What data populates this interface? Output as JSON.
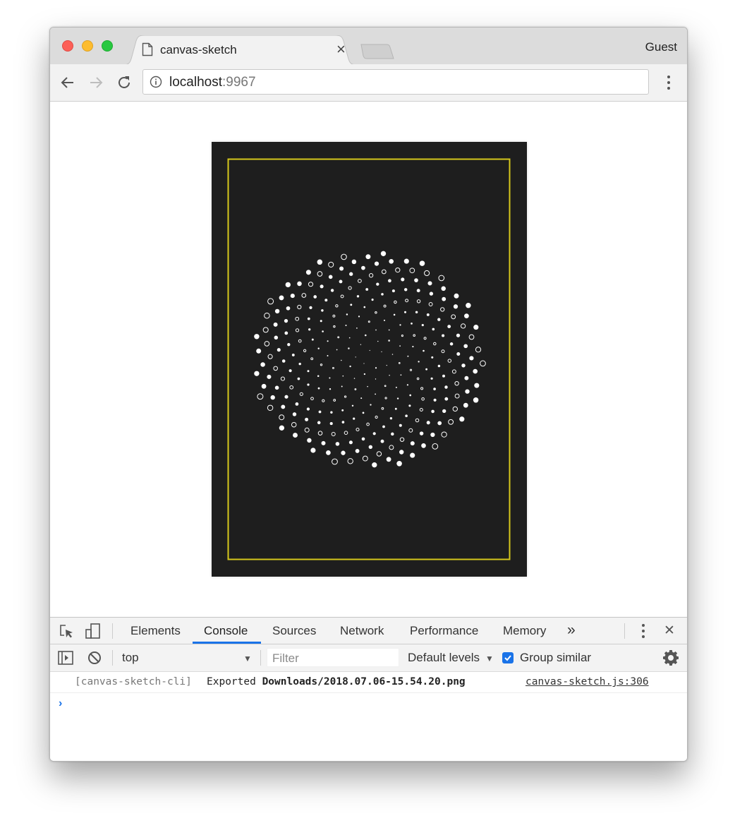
{
  "window": {
    "tab_title": "canvas-sketch",
    "tab_close": "×",
    "profile": "Guest"
  },
  "address_bar": {
    "host": "localhost",
    "port": ":9967"
  },
  "sketch": {
    "background": "#1e1e1e",
    "border_color": "#d6c81c",
    "dot_color": "#ffffff"
  },
  "devtools": {
    "tabs": [
      "Elements",
      "Console",
      "Sources",
      "Network",
      "Performance",
      "Memory"
    ],
    "active_tab": "Console",
    "more_tabs": "»",
    "close": "✕",
    "context": "top",
    "filter_placeholder": "Filter",
    "levels": "Default levels",
    "group_similar": "Group similar",
    "group_similar_checked": true,
    "accent": "#1a73e8"
  },
  "console": {
    "messages": [
      {
        "prefix": "[canvas-sketch-cli]",
        "text": "Exported",
        "path": "Downloads/2018.07.06-15.54.20.png",
        "source": "canvas-sketch.js:306"
      }
    ],
    "prompt": "›"
  }
}
